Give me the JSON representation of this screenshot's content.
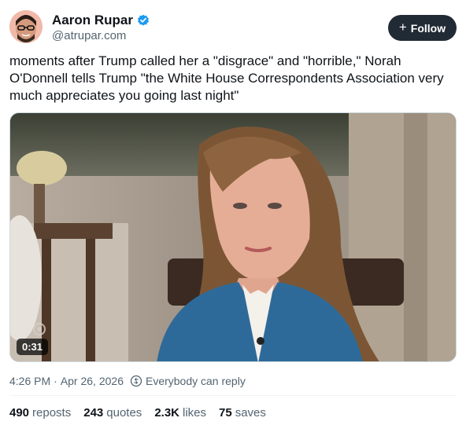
{
  "author": {
    "display_name": "Aaron Rupar",
    "handle": "@atrupar.com",
    "verified_icon": "verified-badge-icon",
    "avatar_icon": "avatar"
  },
  "follow_button": {
    "label": "Follow",
    "icon": "plus-icon"
  },
  "post": {
    "text": "moments after Trump called her a \"disgrace\" and \"horrible,\" Norah O'Donnell tells Trump \"the White House Correspondents Association very much appreciates you going last night\""
  },
  "video": {
    "duration": "0:31"
  },
  "meta": {
    "time": "4:26 PM",
    "separator": "·",
    "date": "Apr 26, 2026",
    "reply_setting": "Everybody can reply",
    "reply_icon": "reply-settings-icon"
  },
  "stats": [
    {
      "count": "490",
      "label": "reposts"
    },
    {
      "count": "243",
      "label": "quotes"
    },
    {
      "count": "2.3K",
      "label": "likes"
    },
    {
      "count": "75",
      "label": "saves"
    }
  ],
  "colors": {
    "text_primary": "#0f1419",
    "text_secondary": "#536471",
    "follow_bg": "#212b36",
    "verified": "#1d9bf0"
  }
}
